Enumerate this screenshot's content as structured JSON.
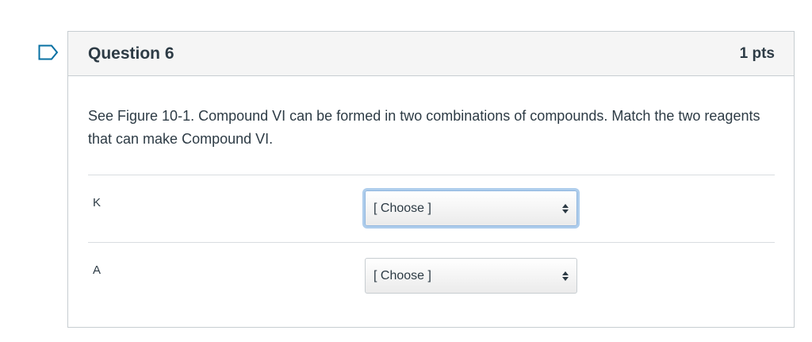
{
  "question": {
    "title": "Question 6",
    "points": "1 pts",
    "text": "See Figure 10-1.  Compound VI can be formed in two combinations of compounds.  Match the two reagents that can make Compound VI.",
    "answers": [
      {
        "label": "K",
        "selected": "[ Choose ]"
      },
      {
        "label": "A",
        "selected": "[ Choose ]"
      }
    ]
  },
  "icons": {
    "flag": "flag-outline-icon",
    "select_arrows": "up-down-arrows-icon"
  },
  "colors": {
    "flag_border": "#0770a3",
    "text": "#2d3b45",
    "header_bg": "#f5f5f5",
    "border": "#c7cdd1",
    "focus_ring": "#aecdec"
  }
}
